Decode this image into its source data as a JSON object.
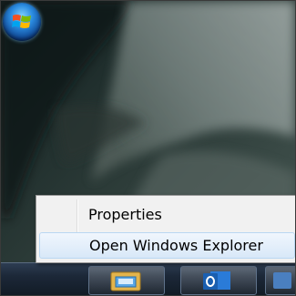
{
  "context_menu": {
    "items": [
      {
        "label": "Properties"
      },
      {
        "label": "Open Windows Explorer"
      }
    ]
  },
  "taskbar": {
    "buttons": [
      {
        "icon": "windows-explorer-icon"
      },
      {
        "icon": "outlook-icon"
      },
      {
        "icon": "app-icon"
      }
    ]
  },
  "colors": {
    "menu_background": "#f1f1f1",
    "menu_highlight": "#d8e8f8",
    "taskbar": "#1c2838"
  }
}
